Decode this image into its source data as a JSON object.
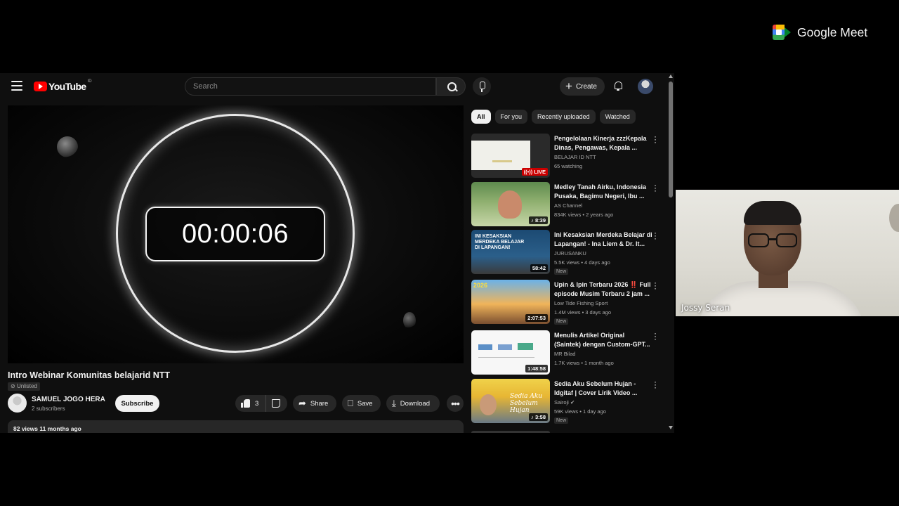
{
  "youtube": {
    "logo_text": "YouTube",
    "logo_region": "ID",
    "search_placeholder": "Search",
    "create_label": "Create",
    "player": {
      "timer": "00:00:06"
    },
    "video": {
      "title": "Intro Webinar Komunitas belajarid NTT",
      "visibility": "Unlisted",
      "channel_name": "SAMUEL JOGO HERA",
      "subscribers": "2 subscribers",
      "subscribe_label": "Subscribe",
      "likes": "3",
      "share_label": "Share",
      "save_label": "Save",
      "download_label": "Download",
      "views_age": "82 views  11 months ago"
    },
    "chips": [
      "All",
      "For you",
      "Recently uploaded",
      "Watched"
    ],
    "recommendations": [
      {
        "title": "Pengelolaan Kinerja zzzKepala Dinas, Pengawas, Kepala ...",
        "channel": "BELAJAR ID NTT",
        "meta": "65 watching",
        "badge": "LIVE",
        "new": ""
      },
      {
        "title": "Medley  Tanah Airku, Indonesia Pusaka, Bagimu Negeri, Ibu ...",
        "channel": "AS Channel",
        "meta": "834K views • 2 years ago",
        "badge": "8:39",
        "new": ""
      },
      {
        "title": "Ini Kesaksian Merdeka Belajar di Lapangan! - Ina Liem & Dr. It...",
        "channel": "JURUSANKU",
        "meta": "5.5K views • 4 days ago",
        "badge": "58:42",
        "new": "New"
      },
      {
        "title": "Upin & Ipin Terbaru 2026 ‼️ Full episode Musim Terbaru 2 jam ...",
        "channel": "Low Tide Fishing Sport",
        "meta": "1.4M views • 3 days ago",
        "badge": "2:07:53",
        "new": "New"
      },
      {
        "title": "Menulis Artikel Original (Saintek) dengan Custom-GPT...",
        "channel": "MR Bilad",
        "meta": "1.7K views • 1 month ago",
        "badge": "1:48:58",
        "new": ""
      },
      {
        "title": "Sedia Aku Sebelum Hujan - Idgitaf | Cover Lirik Video ...",
        "channel": "Sairoji",
        "meta": "59K views • 1 day ago",
        "badge": "3:58",
        "new": "New"
      }
    ],
    "thumb_texts": {
      "t3": "INI KESAKSIAN\nMERDEKA BELAJAR\nDI LAPANGAN!",
      "t4": "2026",
      "t6": "Sedia Aku\nSebelum Hujan"
    }
  },
  "meet": {
    "brand": "Google Meet",
    "participant_name": "Jossy Seran"
  },
  "colors": {
    "yt_red": "#ff0000",
    "live_red": "#cc0000",
    "yt_bg": "#0f0f0f"
  }
}
